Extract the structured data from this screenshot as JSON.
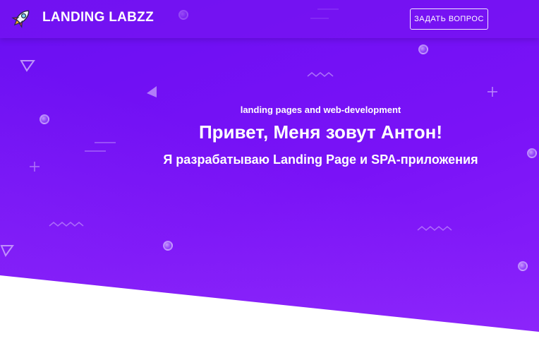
{
  "header": {
    "brand": "LANDING LABZZ",
    "logo_icon": "rocket-icon",
    "cta_label": "ЗАДАТЬ ВОПРОС"
  },
  "hero": {
    "subtitle": "landing pages and web-development",
    "headline": "Привет, Меня зовут Антон!",
    "tagline": "Я разрабатываю Landing Page и SPA-приложения"
  },
  "colors": {
    "hero_primary": "#6a0ff2",
    "hero_secondary": "#8a22fb",
    "text": "#ffffff",
    "logo_accent": "#e0245e"
  }
}
